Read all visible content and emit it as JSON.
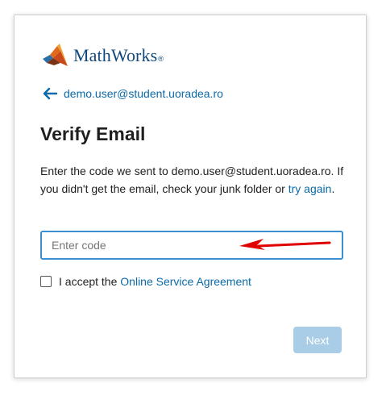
{
  "brand": {
    "name": "MathWorks",
    "registered_mark": "®",
    "logo_icon": "matlab-membrane-logo"
  },
  "back": {
    "icon": "arrow-left-icon",
    "email": "demo.user@student.uoradea.ro"
  },
  "page": {
    "title": "Verify Email"
  },
  "instructions": {
    "text": "Enter the code we sent to demo.user@student.uoradea.ro. If you didn't get the email, check your junk folder or",
    "retry_link": "try again",
    "end": "."
  },
  "code_field": {
    "placeholder": "Enter code",
    "value": ""
  },
  "agreement": {
    "checked": false,
    "prefix": "I accept the",
    "link": "Online Service Agreement"
  },
  "actions": {
    "next_label": "Next",
    "next_enabled": false
  },
  "colors": {
    "link": "#0b6aa8",
    "brand_text": "#12497c",
    "input_focus_border": "#3b8fd0",
    "button_disabled_bg": "#a9cde6",
    "annotation_arrow": "#e00000"
  }
}
